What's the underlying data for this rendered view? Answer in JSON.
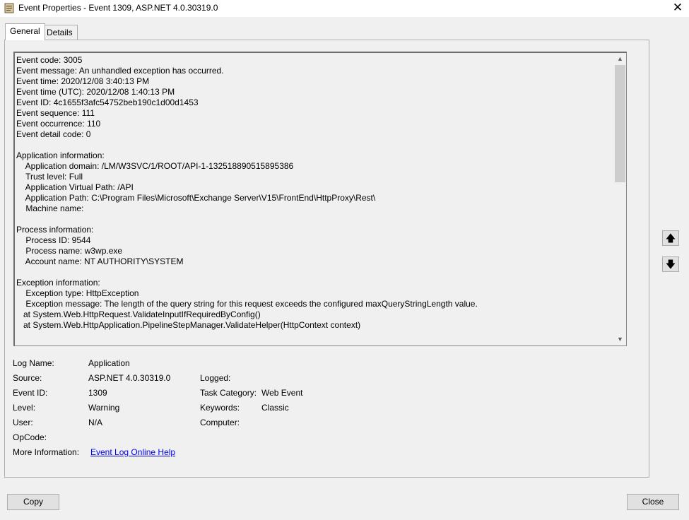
{
  "window": {
    "title": "Event Properties - Event 1309, ASP.NET 4.0.30319.0",
    "close_glyph": "✕"
  },
  "tabs": [
    {
      "label": "General",
      "active": true
    },
    {
      "label": "Details",
      "active": false
    }
  ],
  "description": "Event code: 3005\nEvent message: An unhandled exception has occurred.\nEvent time: 2020/12/08 3:40:13 PM\nEvent time (UTC): 2020/12/08 1:40:13 PM\nEvent ID: 4c1655f3afc54752beb190c1d00d1453\nEvent sequence: 111\nEvent occurrence: 110\nEvent detail code: 0\n\nApplication information:\n    Application domain: /LM/W3SVC/1/ROOT/API-1-132518890515895386\n    Trust level: Full\n    Application Virtual Path: /API\n    Application Path: C:\\Program Files\\Microsoft\\Exchange Server\\V15\\FrontEnd\\HttpProxy\\Rest\\\n    Machine name: \n\nProcess information:\n    Process ID: 9544\n    Process name: w3wp.exe\n    Account name: NT AUTHORITY\\SYSTEM\n\nException information:\n    Exception type: HttpException\n    Exception message: The length of the query string for this request exceeds the configured maxQueryStringLength value.\n   at System.Web.HttpRequest.ValidateInputIfRequiredByConfig()\n   at System.Web.HttpApplication.PipelineStepManager.ValidateHelper(HttpContext context)",
  "scrollbar": {
    "up_glyph": "▲",
    "down_glyph": "▼"
  },
  "nav": {
    "up_glyph": "🡅",
    "down_glyph": "🡇"
  },
  "fields": {
    "log_name_label": "Log Name:",
    "log_name": "Application",
    "source_label": "Source:",
    "source": "ASP.NET 4.0.30319.0",
    "logged_label": "Logged:",
    "logged": "",
    "event_id_label": "Event ID:",
    "event_id": "1309",
    "task_category_label": "Task Category:",
    "task_category": "Web Event",
    "level_label": "Level:",
    "level": "Warning",
    "keywords_label": "Keywords:",
    "keywords": "Classic",
    "user_label": "User:",
    "user": "N/A",
    "computer_label": "Computer:",
    "computer": "",
    "opcode_label": "OpCode:",
    "opcode": "",
    "more_info_label": "More Information:",
    "more_info_link": "Event Log Online Help"
  },
  "buttons": {
    "copy": "Copy",
    "close": "Close"
  }
}
